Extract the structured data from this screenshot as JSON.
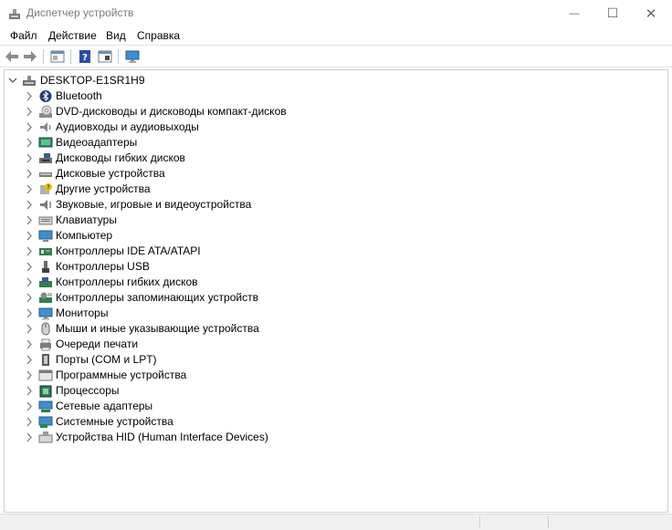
{
  "window": {
    "title": "Диспетчер устройств",
    "controls": {
      "minimize": "—",
      "maximize": "☐",
      "close": "✕"
    }
  },
  "menu": [
    "Файл",
    "Действие",
    "Вид",
    "Справка"
  ],
  "toolbar": {
    "buttons": [
      "back-arrow-icon",
      "forward-arrow-icon",
      "properties-panel-icon",
      "help-icon",
      "update-view-icon",
      "monitor-scan-icon"
    ]
  },
  "tree": {
    "root": "DESKTOP-E1SR1H9",
    "items": [
      {
        "label": "Bluetooth",
        "icon": "bluetooth-icon"
      },
      {
        "label": "DVD-дисководы и дисководы компакт-дисков",
        "icon": "dvd-drive-icon"
      },
      {
        "label": "Аудиовходы и аудиовыходы",
        "icon": "audio-io-icon"
      },
      {
        "label": "Видеоадаптеры",
        "icon": "display-adapter-icon"
      },
      {
        "label": "Дисководы гибких дисков",
        "icon": "floppy-drive-icon"
      },
      {
        "label": "Дисковые устройства",
        "icon": "disk-drive-icon"
      },
      {
        "label": "Другие устройства",
        "icon": "unknown-device-icon"
      },
      {
        "label": "Звуковые, игровые и видеоустройства",
        "icon": "sound-icon"
      },
      {
        "label": "Клавиатуры",
        "icon": "keyboard-icon"
      },
      {
        "label": "Компьютер",
        "icon": "computer-icon"
      },
      {
        "label": "Контроллеры IDE ATA/ATAPI",
        "icon": "ide-controller-icon"
      },
      {
        "label": "Контроллеры USB",
        "icon": "usb-icon"
      },
      {
        "label": "Контроллеры гибких дисков",
        "icon": "floppy-controller-icon"
      },
      {
        "label": "Контроллеры запоминающих устройств",
        "icon": "storage-controller-icon"
      },
      {
        "label": "Мониторы",
        "icon": "monitor-icon"
      },
      {
        "label": "Мыши и иные указывающие устройства",
        "icon": "mouse-icon"
      },
      {
        "label": "Очереди печати",
        "icon": "print-queue-icon"
      },
      {
        "label": "Порты (COM и LPT)",
        "icon": "port-icon"
      },
      {
        "label": "Программные устройства",
        "icon": "software-device-icon"
      },
      {
        "label": "Процессоры",
        "icon": "processor-icon"
      },
      {
        "label": "Сетевые адаптеры",
        "icon": "network-adapter-icon"
      },
      {
        "label": "Системные устройства",
        "icon": "system-device-icon"
      },
      {
        "label": "Устройства HID (Human Interface Devices)",
        "icon": "hid-device-icon"
      }
    ]
  }
}
